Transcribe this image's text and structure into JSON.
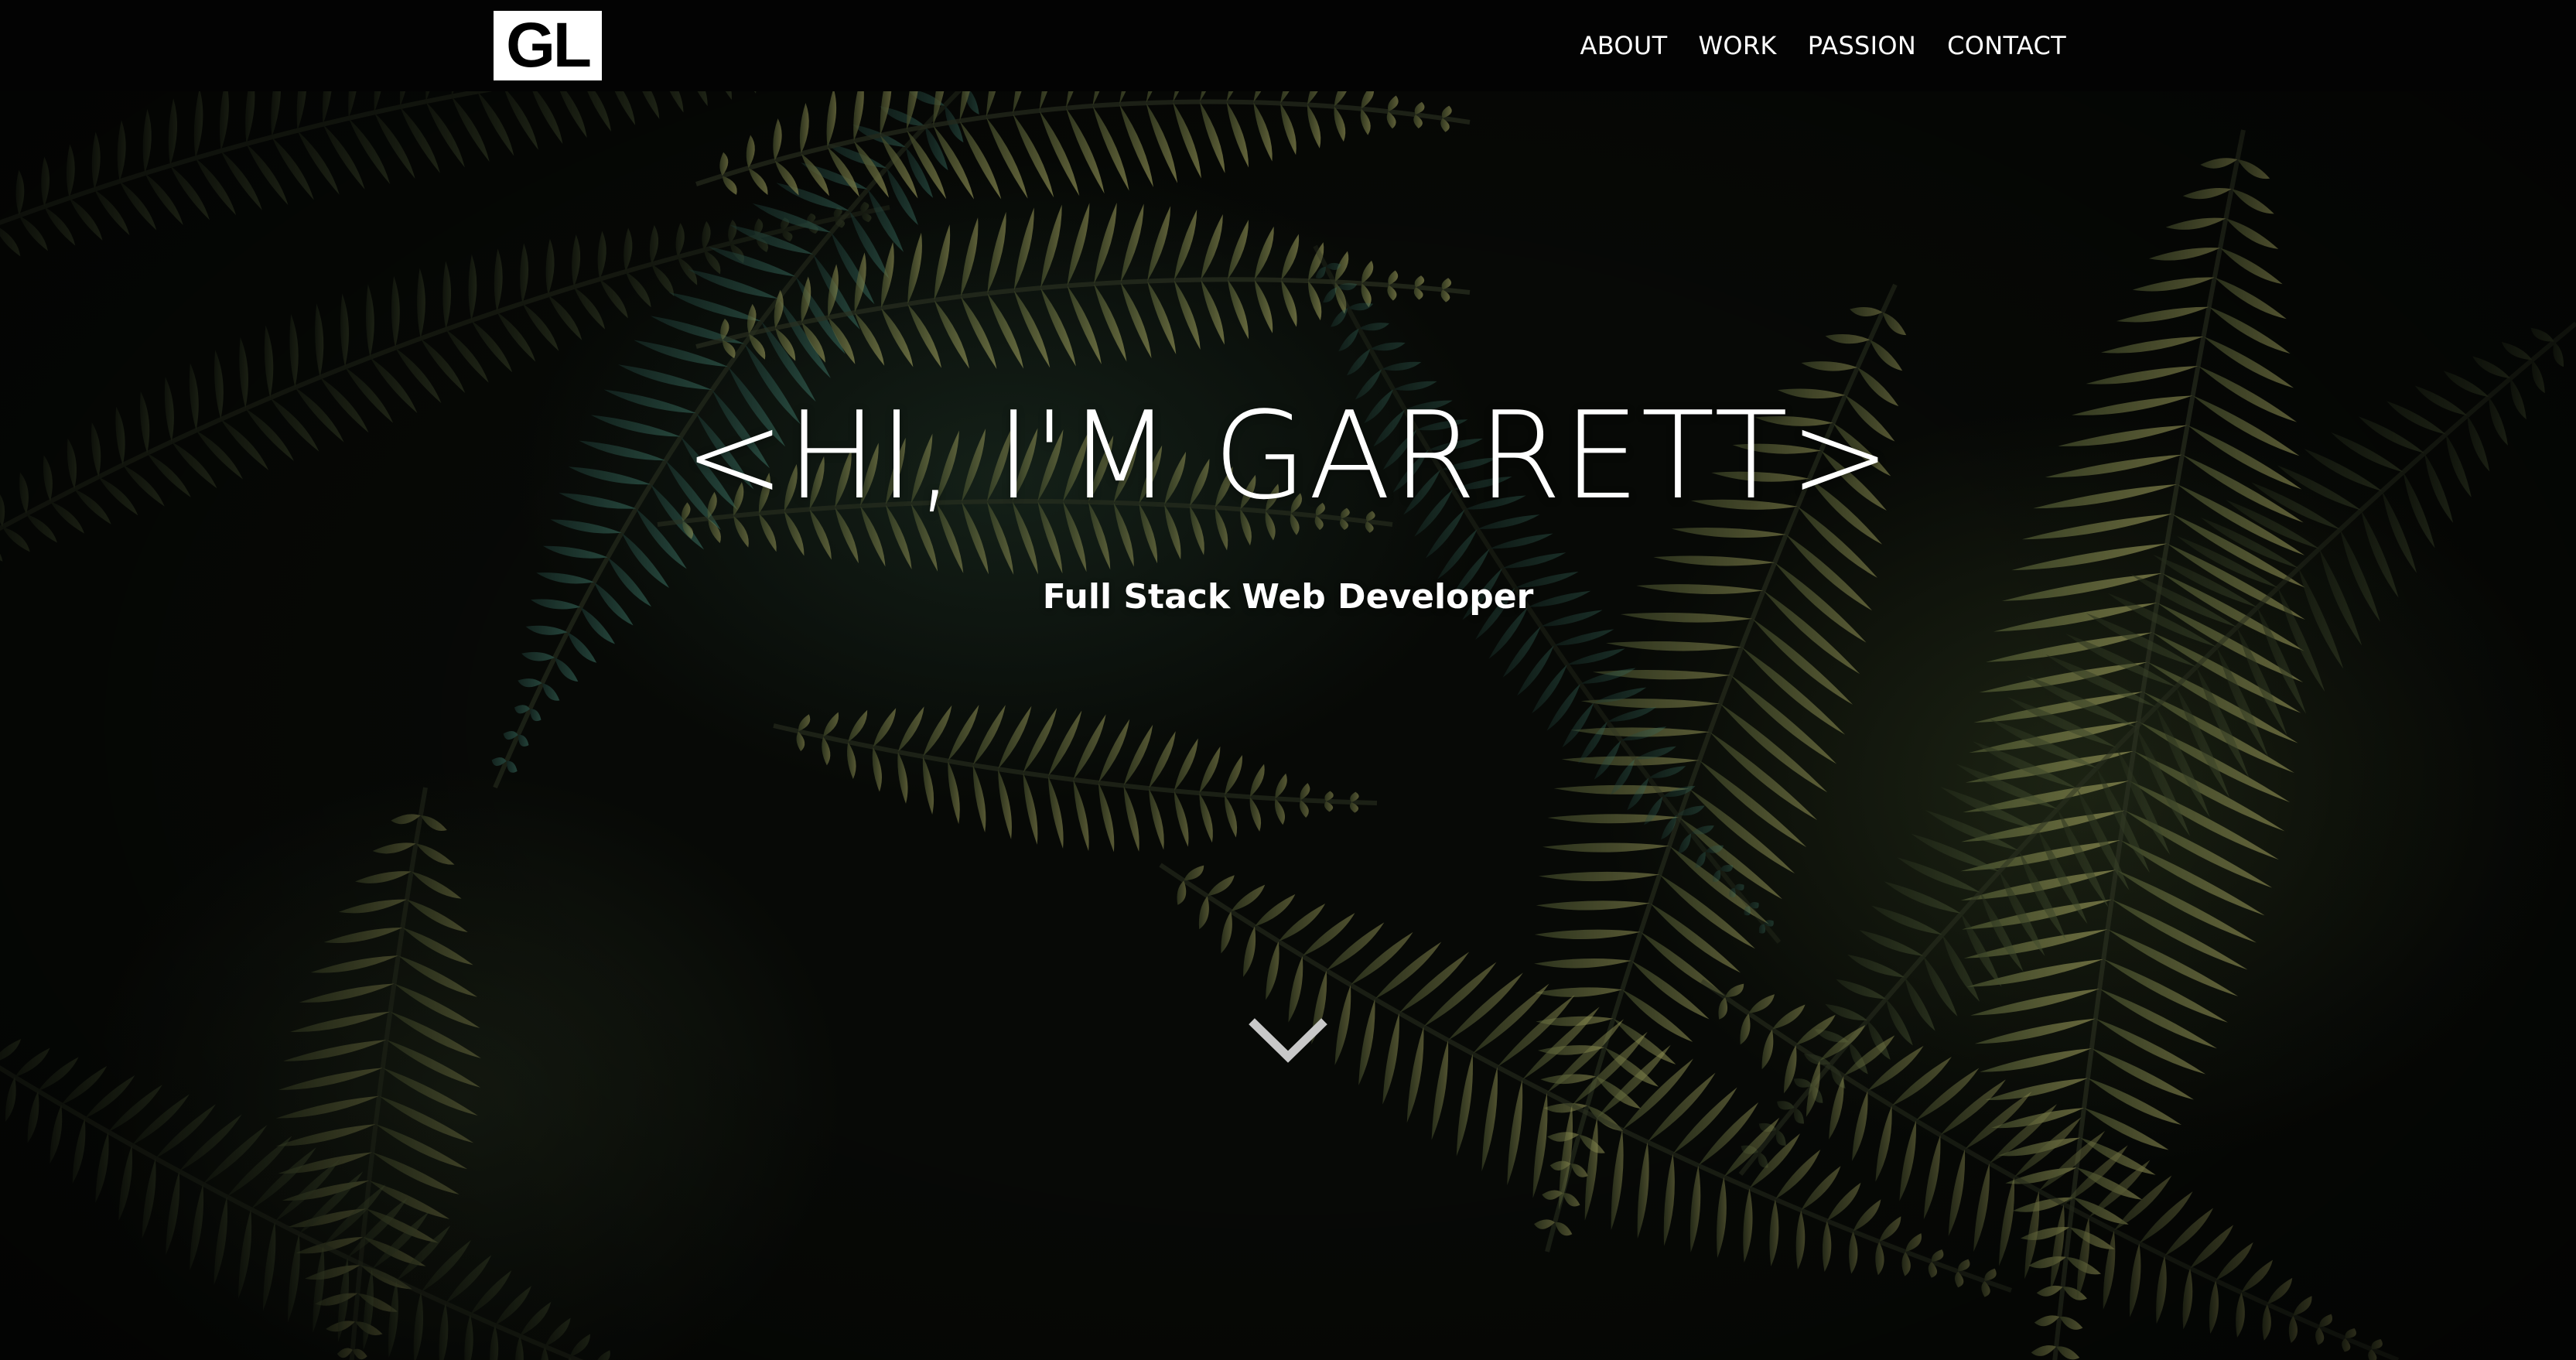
{
  "header": {
    "logo_text": "GL",
    "nav": [
      {
        "label": "ABOUT"
      },
      {
        "label": "WORK"
      },
      {
        "label": "PASSION"
      },
      {
        "label": "CONTACT"
      }
    ]
  },
  "hero": {
    "headline": "<HI, I'M GARRETT>",
    "subtitle": "Full Stack Web Developer",
    "scroll_icon": "chevron-down-icon",
    "background": "fern-leaves-photo"
  },
  "colors": {
    "header_bg": "#030303",
    "text": "#ffffff",
    "logo_bg": "#ffffff",
    "chevron": "#c8c8c8",
    "fern_light": "#8c8f4a",
    "fern_dark": "#3c4a2c",
    "fern_teal": "#2f7a6a"
  }
}
